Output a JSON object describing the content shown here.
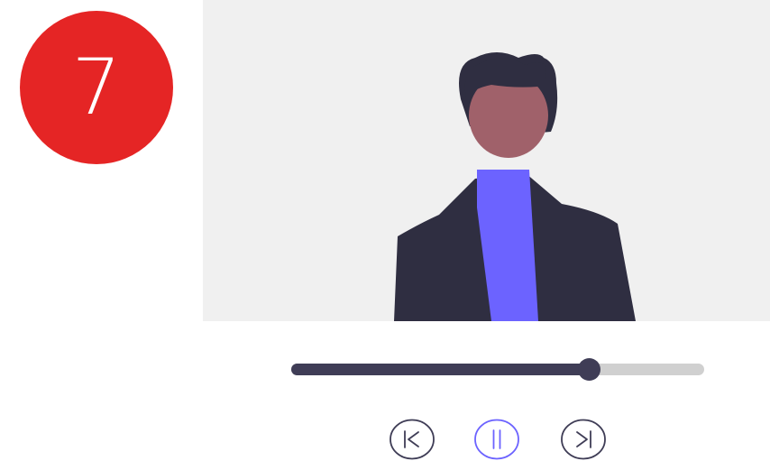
{
  "step_badge": {
    "number": "7",
    "color": "#e52525"
  },
  "video": {
    "background_color": "#f0f0f0",
    "avatar": {
      "hair_color": "#2f2e41",
      "face_color": "#a0616a",
      "shirt_color": "#6c63ff",
      "jacket_color": "#2f2e41"
    }
  },
  "progress": {
    "value": 0.72,
    "fill_color": "#3f3d56",
    "track_color": "#d0d0d0"
  },
  "controls": {
    "icon_color": "#3f3d56",
    "active_color": "#6c63ff",
    "buttons": [
      {
        "name": "previous",
        "icon": "skip-previous-icon"
      },
      {
        "name": "pause",
        "icon": "pause-icon",
        "active": true
      },
      {
        "name": "next",
        "icon": "skip-next-icon"
      }
    ]
  }
}
